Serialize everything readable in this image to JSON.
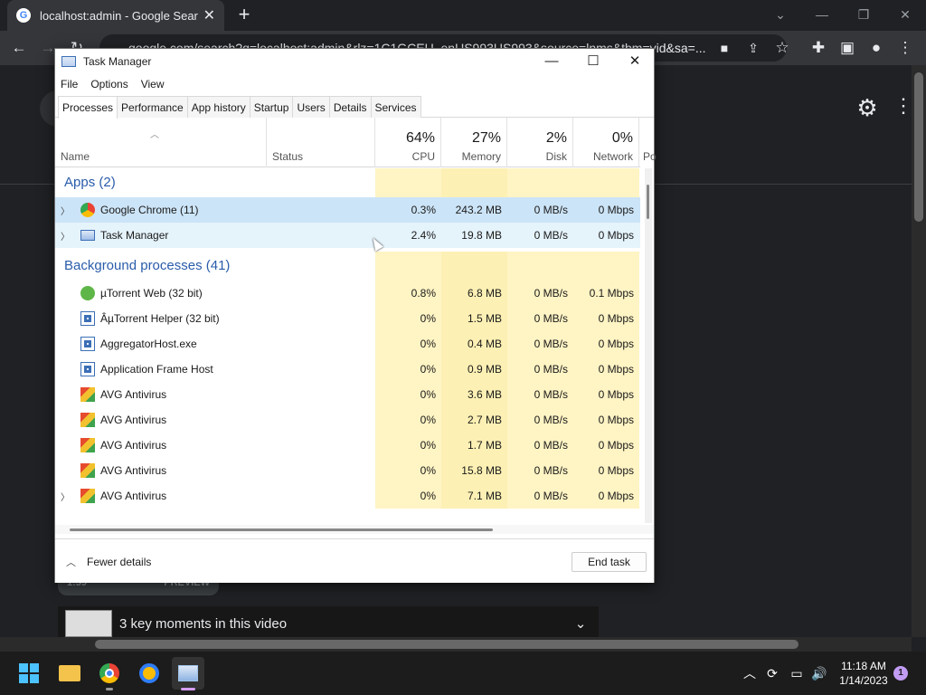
{
  "chrome": {
    "tab_title": "localhost:admin - Google Search",
    "url": "google.com/search?q=localhost:admin&rlz=1C1GCEU_enUS993US993&source=lnms&tbm=vid&sa=...",
    "min": "—",
    "restore": "❐",
    "close": "✕",
    "new_tab": "+"
  },
  "page": {
    "video_time": "1:59",
    "video_tag": "PREVIEW",
    "moments": "3 key moments in this video"
  },
  "taskmanager": {
    "title": "Task Manager",
    "menu": [
      "File",
      "Options",
      "View"
    ],
    "tabs": [
      "Processes",
      "Performance",
      "App history",
      "Startup",
      "Users",
      "Details",
      "Services"
    ],
    "columns": {
      "name": "Name",
      "status": "Status",
      "cpu_pct": "64%",
      "cpu": "CPU",
      "mem_pct": "27%",
      "mem": "Memory",
      "disk_pct": "2%",
      "disk": "Disk",
      "net_pct": "0%",
      "net": "Network",
      "power": "Po"
    },
    "groups": {
      "apps": "Apps (2)",
      "background": "Background processes (41)"
    },
    "apps": [
      {
        "name": "Google Chrome (11)",
        "cpu": "0.3%",
        "mem": "243.2 MB",
        "disk": "0 MB/s",
        "net": "0 Mbps"
      },
      {
        "name": "Task Manager",
        "cpu": "2.4%",
        "mem": "19.8 MB",
        "disk": "0 MB/s",
        "net": "0 Mbps"
      }
    ],
    "background": [
      {
        "name": "µTorrent Web (32 bit)",
        "cpu": "0.8%",
        "mem": "6.8 MB",
        "disk": "0 MB/s",
        "net": "0.1 Mbps"
      },
      {
        "name": "ÂµTorrent Helper (32 bit)",
        "cpu": "0%",
        "mem": "1.5 MB",
        "disk": "0 MB/s",
        "net": "0 Mbps"
      },
      {
        "name": "AggregatorHost.exe",
        "cpu": "0%",
        "mem": "0.4 MB",
        "disk": "0 MB/s",
        "net": "0 Mbps"
      },
      {
        "name": "Application Frame Host",
        "cpu": "0%",
        "mem": "0.9 MB",
        "disk": "0 MB/s",
        "net": "0 Mbps"
      },
      {
        "name": "AVG Antivirus",
        "cpu": "0%",
        "mem": "3.6 MB",
        "disk": "0 MB/s",
        "net": "0 Mbps"
      },
      {
        "name": "AVG Antivirus",
        "cpu": "0%",
        "mem": "2.7 MB",
        "disk": "0 MB/s",
        "net": "0 Mbps"
      },
      {
        "name": "AVG Antivirus",
        "cpu": "0%",
        "mem": "1.7 MB",
        "disk": "0 MB/s",
        "net": "0 Mbps"
      },
      {
        "name": "AVG Antivirus",
        "cpu": "0%",
        "mem": "15.8 MB",
        "disk": "0 MB/s",
        "net": "0 Mbps"
      },
      {
        "name": "AVG Antivirus",
        "cpu": "0%",
        "mem": "7.1 MB",
        "disk": "0 MB/s",
        "net": "0 Mbps"
      }
    ],
    "fewer_details": "Fewer details",
    "end_task": "End task"
  },
  "taskbar": {
    "time": "11:18 AM",
    "date": "1/14/2023",
    "notifications": "1"
  },
  "colors": {
    "cpu_tint": "#fff4c4",
    "mem_tint": "#fdf0b4",
    "group_blue": "#2a5caa"
  }
}
